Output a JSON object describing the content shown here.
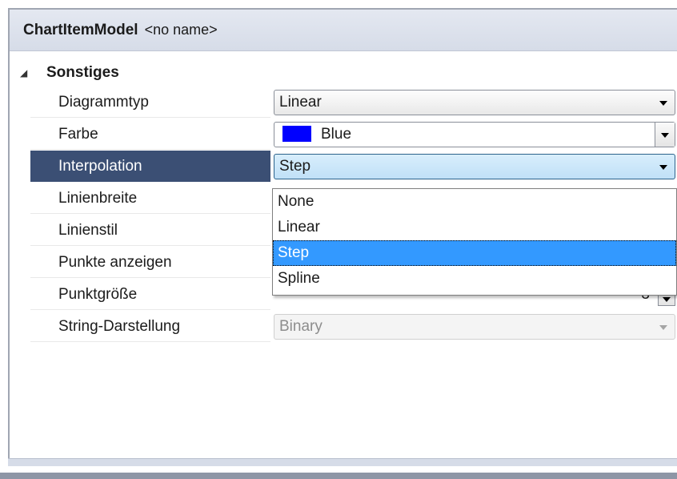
{
  "header": {
    "type_name": "ChartItemModel",
    "object_name": "<no name>"
  },
  "category": {
    "label": "Sonstiges"
  },
  "properties": [
    {
      "label": "Diagrammtyp",
      "value": "Linear"
    },
    {
      "label": "Farbe",
      "value": "Blue",
      "color": "#0000ff"
    },
    {
      "label": "Interpolation",
      "value": "Step"
    },
    {
      "label": "Linienbreite",
      "value": ""
    },
    {
      "label": "Linienstil",
      "value": ""
    },
    {
      "label": "Punkte anzeigen",
      "value": ""
    },
    {
      "label": "Punktgröße",
      "value": "3"
    },
    {
      "label": "String-Darstellung",
      "value": "Binary"
    }
  ],
  "dropdown": {
    "options": [
      "None",
      "Linear",
      "Step",
      "Spline"
    ],
    "selected": "Step"
  },
  "colors": {
    "selection_row": "#3b4f74",
    "highlight": "#3399ff",
    "swatch": "#0000ff"
  }
}
